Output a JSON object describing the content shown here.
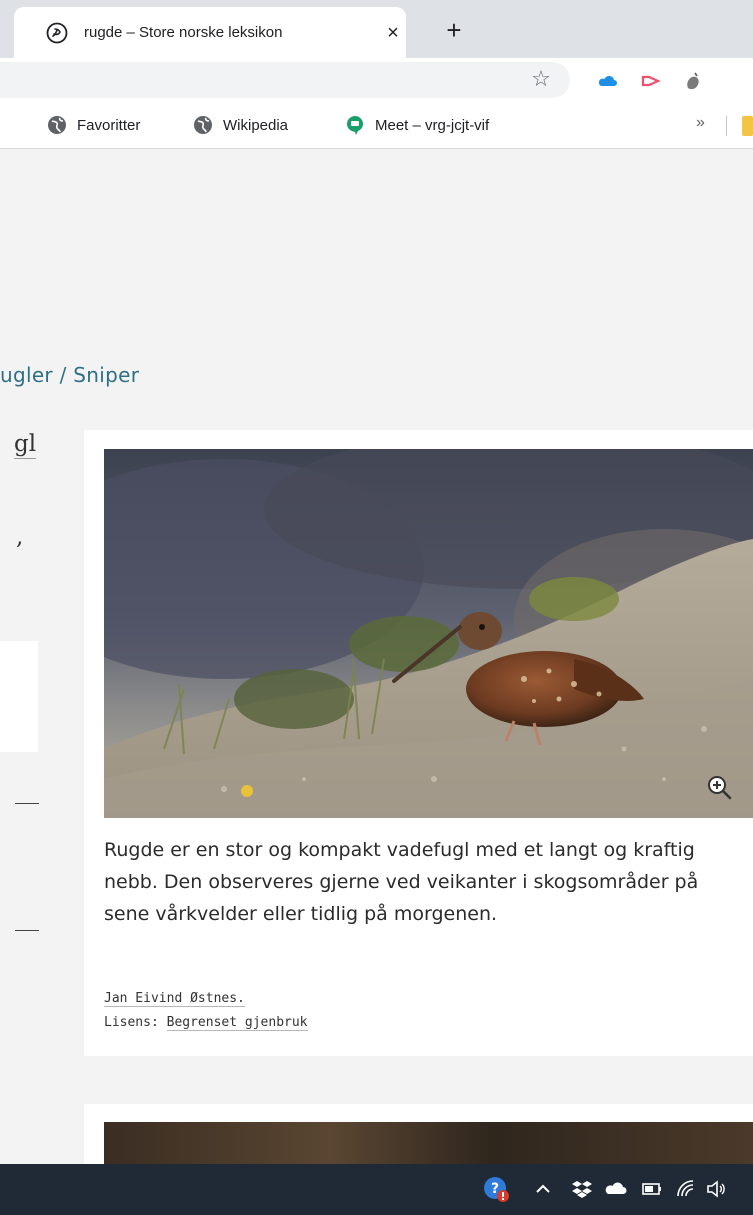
{
  "browser": {
    "tab": {
      "title": "rugde – Store norske leksikon",
      "close_glyph": "×"
    },
    "new_tab_glyph": "+",
    "star_glyph": "☆",
    "bookmarks": [
      {
        "label": "Favoritter",
        "icon": "globe-icon"
      },
      {
        "label": "Wikipedia",
        "icon": "globe-icon"
      },
      {
        "label": "Meet – vrg-jcjt-vif",
        "icon": "meet-icon"
      }
    ],
    "bookmarks_more": "»",
    "extensions": [
      "onedrive-icon",
      "cast-icon",
      "extension-icon"
    ]
  },
  "page": {
    "breadcrumb": "ugler / Sniper",
    "left_fragment_1": "gl",
    "left_fragment_2": ",",
    "figure": {
      "caption": "Rugde er en stor og kompakt vadefugl med et langt og kraftig nebb. Den observeres gjerne ved veikanter i skogsområder på sene vårkvelder eller tidlig på morgenen.",
      "credit_author": "Jan Eivind Østnes.",
      "license_label": "Lisens:",
      "license_value": "Begrenset gjenbruk"
    }
  },
  "taskbar": {
    "tray_icons": [
      "help-alert-icon",
      "chevron-up-icon",
      "dropbox-icon",
      "onedrive-icon",
      "battery-icon",
      "wifi-icon",
      "speaker-icon"
    ]
  },
  "colors": {
    "accent_link": "#2f6f86",
    "page_bg": "#f3f3f3",
    "taskbar_bg": "#1f2a36"
  }
}
